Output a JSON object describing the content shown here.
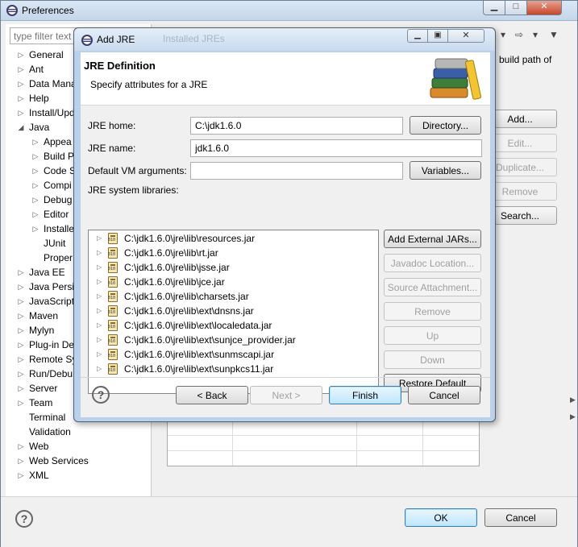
{
  "prefs": {
    "title": "Preferences",
    "filter_placeholder": "type filter text",
    "tree": [
      {
        "label": "General",
        "level": 0,
        "arrow": "▷"
      },
      {
        "label": "Ant",
        "level": 0,
        "arrow": "▷"
      },
      {
        "label": "Data Mana",
        "level": 0,
        "arrow": "▷"
      },
      {
        "label": "Help",
        "level": 0,
        "arrow": "▷"
      },
      {
        "label": "Install/Upd",
        "level": 0,
        "arrow": "▷"
      },
      {
        "label": "Java",
        "level": 0,
        "arrow": "◢"
      },
      {
        "label": "Appea",
        "level": 1,
        "arrow": "▷"
      },
      {
        "label": "Build P",
        "level": 1,
        "arrow": "▷"
      },
      {
        "label": "Code S",
        "level": 1,
        "arrow": "▷"
      },
      {
        "label": "Compi",
        "level": 1,
        "arrow": "▷"
      },
      {
        "label": "Debug",
        "level": 1,
        "arrow": "▷"
      },
      {
        "label": "Editor",
        "level": 1,
        "arrow": "▷"
      },
      {
        "label": "Installe",
        "level": 1,
        "arrow": "▷"
      },
      {
        "label": "JUnit",
        "level": 1,
        "arrow": ""
      },
      {
        "label": "Proper",
        "level": 1,
        "arrow": ""
      },
      {
        "label": "Java EE",
        "level": 0,
        "arrow": "▷"
      },
      {
        "label": "Java Persis",
        "level": 0,
        "arrow": "▷"
      },
      {
        "label": "JavaScript",
        "level": 0,
        "arrow": "▷"
      },
      {
        "label": "Maven",
        "level": 0,
        "arrow": "▷"
      },
      {
        "label": "Mylyn",
        "level": 0,
        "arrow": "▷"
      },
      {
        "label": "Plug-in De",
        "level": 0,
        "arrow": "▷"
      },
      {
        "label": "Remote Sy",
        "level": 0,
        "arrow": "▷"
      },
      {
        "label": "Run/Debu",
        "level": 0,
        "arrow": "▷"
      },
      {
        "label": "Server",
        "level": 0,
        "arrow": "▷"
      },
      {
        "label": "Team",
        "level": 0,
        "arrow": "▷"
      },
      {
        "label": "Terminal",
        "level": 0,
        "arrow": ""
      },
      {
        "label": "Validation",
        "level": 0,
        "arrow": ""
      },
      {
        "label": "Web",
        "level": 0,
        "arrow": "▷"
      },
      {
        "label": "Web Services",
        "level": 0,
        "arrow": "▷"
      },
      {
        "label": "XML",
        "level": 0,
        "arrow": "▷"
      }
    ],
    "right_header": "build path of",
    "side_buttons": [
      {
        "label": "Add...",
        "enabled": true
      },
      {
        "label": "Edit...",
        "enabled": false
      },
      {
        "label": "Duplicate...",
        "enabled": false
      },
      {
        "label": "Remove",
        "enabled": false
      },
      {
        "label": "Search...",
        "enabled": true
      }
    ],
    "ok_label": "OK",
    "cancel_label": "Cancel",
    "help_glyph": "?"
  },
  "dialog": {
    "title": "Add JRE",
    "ghost_title": "Installed JREs",
    "banner_title": "JRE Definition",
    "banner_subtitle": "Specify attributes for a JRE",
    "jre_home_label": "JRE home:",
    "jre_home_value": "C:\\jdk1.6.0",
    "jre_name_label": "JRE name:",
    "jre_name_value": "jdk1.6.0",
    "vm_args_label": "Default VM arguments:",
    "vm_args_value": "",
    "directory_label": "Directory...",
    "variables_label": "Variables...",
    "libraries_label": "JRE system libraries:",
    "libraries": [
      "C:\\jdk1.6.0\\jre\\lib\\resources.jar",
      "C:\\jdk1.6.0\\jre\\lib\\rt.jar",
      "C:\\jdk1.6.0\\jre\\lib\\jsse.jar",
      "C:\\jdk1.6.0\\jre\\lib\\jce.jar",
      "C:\\jdk1.6.0\\jre\\lib\\charsets.jar",
      "C:\\jdk1.6.0\\jre\\lib\\ext\\dnsns.jar",
      "C:\\jdk1.6.0\\jre\\lib\\ext\\localedata.jar",
      "C:\\jdk1.6.0\\jre\\lib\\ext\\sunjce_provider.jar",
      "C:\\jdk1.6.0\\jre\\lib\\ext\\sunmscapi.jar",
      "C:\\jdk1.6.0\\jre\\lib\\ext\\sunpkcs11.jar"
    ],
    "lib_buttons": [
      {
        "label": "Add External JARs...",
        "enabled": true
      },
      {
        "label": "Javadoc Location...",
        "enabled": false
      },
      {
        "label": "Source Attachment...",
        "enabled": false
      },
      {
        "label": "Remove",
        "enabled": false
      },
      {
        "label": "Up",
        "enabled": false
      },
      {
        "label": "Down",
        "enabled": false
      },
      {
        "label": "Restore Default",
        "enabled": true
      }
    ],
    "back_label": "< Back",
    "next_label": "Next >",
    "finish_label": "Finish",
    "cancel_label": "Cancel",
    "help_glyph": "?"
  }
}
